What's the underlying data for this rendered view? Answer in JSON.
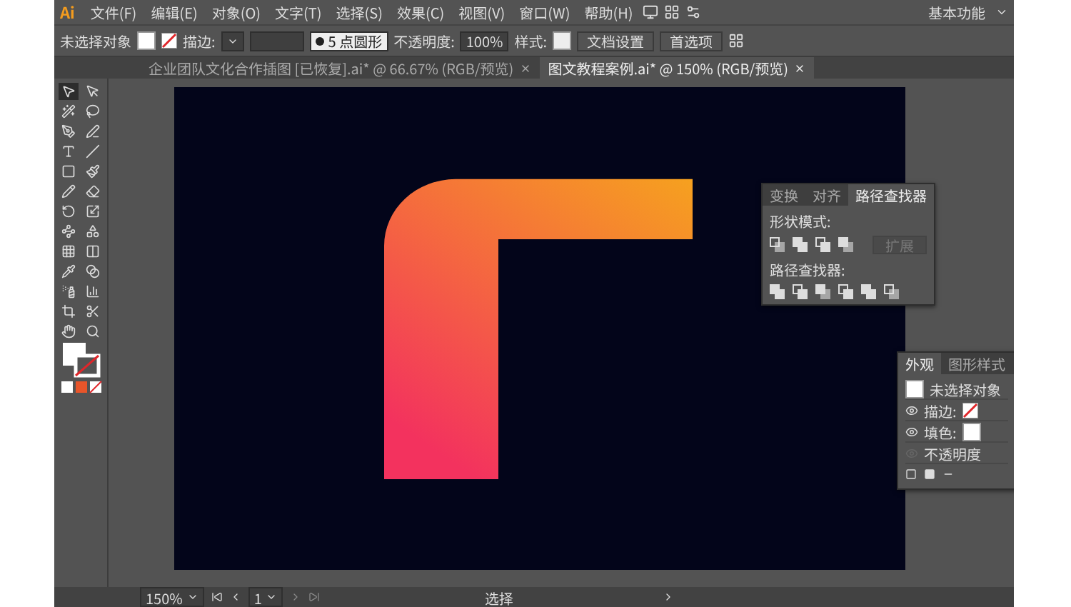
{
  "menu_bar": {
    "logo": "Ai",
    "items": [
      "文件(F)",
      "编辑(E)",
      "对象(O)",
      "文字(T)",
      "选择(S)",
      "效果(C)",
      "视图(V)",
      "窗口(W)",
      "帮助(H)"
    ],
    "workspace": "基本功能"
  },
  "control_bar": {
    "selection": "未选择对象",
    "stroke_label": "描边:",
    "brush": "5 点圆形",
    "opacity_label": "不透明度:",
    "opacity": "100%",
    "style_label": "样式:",
    "buttons": [
      "文档设置",
      "首选项"
    ]
  },
  "tabs": [
    {
      "label": "企业团队文化合作插图 [已恢复].ai* @ 66.67% (RGB/预览)",
      "selected": false
    },
    {
      "label": "图文教程案例.ai* @ 150% (RGB/预览)",
      "selected": true
    }
  ],
  "tool_panel": {
    "tools": [
      {
        "selected": true
      },
      {
        "selected": false
      },
      {
        "selected": false
      },
      {
        "selected": false
      },
      {
        "selected": false
      },
      {
        "selected": false
      },
      {
        "selected": false
      },
      {
        "selected": false
      },
      {
        "selected": false
      },
      {
        "selected": false
      },
      {
        "selected": false
      },
      {
        "selected": false
      },
      {
        "selected": false
      },
      {
        "selected": false
      },
      {
        "selected": false
      },
      {
        "selected": false
      },
      {
        "selected": false
      },
      {
        "selected": false
      },
      {
        "selected": false
      },
      {
        "selected": false
      },
      {
        "selected": false
      },
      {
        "selected": false
      },
      {
        "selected": false
      },
      {
        "selected": false
      },
      {
        "selected": false
      },
      {
        "selected": false
      }
    ]
  },
  "pathfinder_panel": {
    "tabs": [
      {
        "label": "变换",
        "selected": false
      },
      {
        "label": "对齐",
        "selected": false
      },
      {
        "label": "路径查找器",
        "selected": true
      }
    ],
    "shape_modes_label": "形状模式:",
    "expand_button": {
      "label": "扩展",
      "disabled": true
    },
    "pathfinders_label": "路径查找器:"
  },
  "appearance_panel": {
    "tabs": [
      {
        "label": "外观",
        "selected": true
      },
      {
        "label": "图形样式",
        "selected": false
      }
    ],
    "object": "未选择对象",
    "rows": [
      {
        "label": "描边:",
        "visible": true,
        "no_color": true
      },
      {
        "label": "填色:",
        "visible": true,
        "no_color": false
      },
      {
        "label": "不透明度",
        "visible": false
      }
    ]
  },
  "status_bar": {
    "zoom": "150%",
    "page": "1",
    "tool": "选择"
  }
}
